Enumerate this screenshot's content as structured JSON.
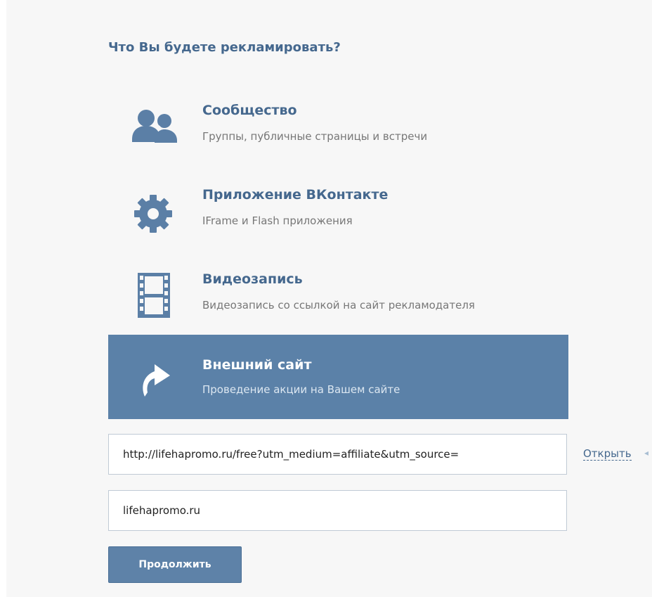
{
  "heading": "Что Вы будете рекламировать?",
  "options": [
    {
      "title": "Сообщество",
      "description": "Группы, публичные страницы и встречи",
      "icon": "community-icon",
      "selected": false
    },
    {
      "title": "Приложение ВКонтакте",
      "description": "IFrame и Flash приложения",
      "icon": "gear-icon",
      "selected": false
    },
    {
      "title": "Видеозапись",
      "description": "Видеозапись со ссылкой на сайт рекламодателя",
      "icon": "film-icon",
      "selected": false
    },
    {
      "title": "Внешний сайт",
      "description": "Проведение акции на Вашем сайте",
      "icon": "external-link-arrow-icon",
      "selected": true
    }
  ],
  "url_field": {
    "value": "http://lifehapromo.ru/free?utm_medium=affiliate&utm_source="
  },
  "open_link": {
    "label": "Открыть",
    "icon": "arrow-icon"
  },
  "domain_field": {
    "value": "lifehapromo.ru"
  },
  "continue_button": {
    "label": "Продолжить"
  },
  "colors": {
    "accent": "#45688e",
    "selected_background": "#5b81a8",
    "button": "#5e82a8",
    "panel_background": "#f7f7f7"
  }
}
